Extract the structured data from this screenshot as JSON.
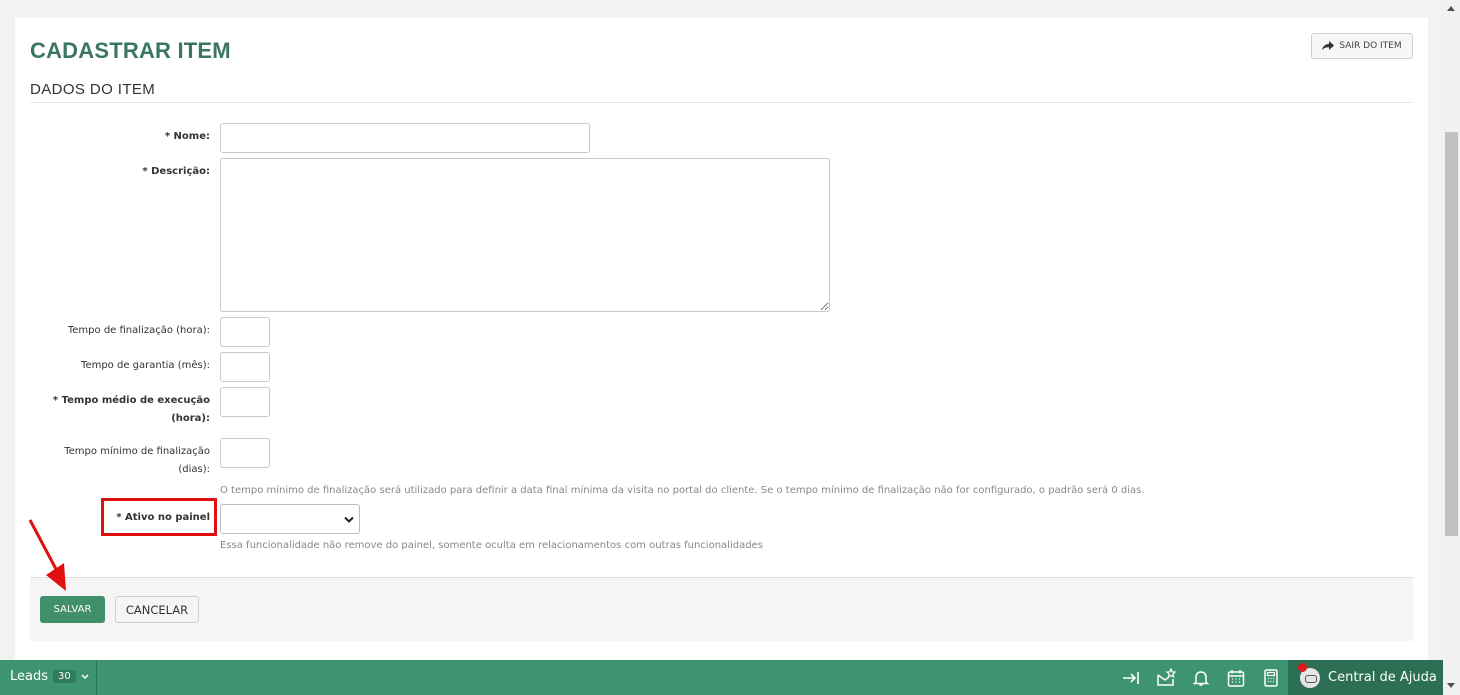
{
  "header": {
    "title": "CADASTRAR ITEM",
    "exit_label": "SAIR DO ITEM"
  },
  "section": {
    "title": "DADOS DO ITEM"
  },
  "form": {
    "nome_label": "* Nome:",
    "nome_value": "",
    "descricao_label": "* Descrição:",
    "descricao_value": "",
    "tempo_finalizacao_label": "Tempo de finalização (hora):",
    "tempo_finalizacao_value": "",
    "tempo_garantia_label": "Tempo de garantia (mês):",
    "tempo_garantia_value": "",
    "tempo_medio_label_1": "* Tempo médio de execução",
    "tempo_medio_label_2": "(hora):",
    "tempo_medio_value": "",
    "tempo_minimo_label_1": "Tempo mínimo de finalização",
    "tempo_minimo_label_2": "(dias):",
    "tempo_minimo_value": "",
    "tempo_minimo_help": "O tempo mínimo de finalização será utilizado para definir a data final mínima da visita no portal do cliente. Se o tempo mínimo de finalização não for configurado, o padrão será 0 dias.",
    "ativo_label": "* Ativo no painel",
    "ativo_value": "",
    "ativo_help": "Essa funcionalidade não remove do painel, somente oculta em relacionamentos com outras funcionalidades"
  },
  "footer": {
    "save_label": "SALVAR",
    "cancel_label": "CANCELAR"
  },
  "bottombar": {
    "leads_label": "Leads",
    "leads_count": "30",
    "help_center_label": "Central de Ajuda",
    "icons": [
      "arrow-to-right-icon",
      "envelope-star-icon",
      "bell-icon",
      "calendar-icon",
      "calculator-icon"
    ]
  },
  "colors": {
    "title": "#3a7566",
    "primary": "#3e8f6a",
    "bottombar": "#3e9470",
    "highlight": "#e01010"
  }
}
